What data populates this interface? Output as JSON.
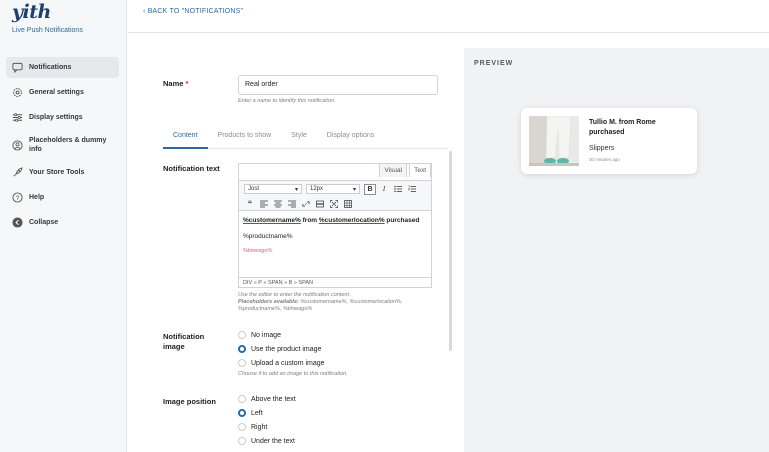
{
  "sidebar": {
    "logo_text": "yith",
    "plugin_name": "Live Push Notifications",
    "items": [
      {
        "label": "Notifications",
        "icon": "chat-icon"
      },
      {
        "label": "General settings",
        "icon": "gear-icon"
      },
      {
        "label": "Display settings",
        "icon": "sliders-icon"
      },
      {
        "label": "Placeholders & dummy info",
        "icon": "person-icon"
      },
      {
        "label": "Your Store Tools",
        "icon": "rocket-icon"
      },
      {
        "label": "Help",
        "icon": "help-icon"
      },
      {
        "label": "Collapse",
        "icon": "collapse-icon"
      }
    ]
  },
  "header": {
    "back_link": "BACK TO \"NOTIFICATIONS\""
  },
  "form": {
    "name_label": "Name",
    "name_required": "*",
    "name_value": "Real order",
    "name_hint": "Enter a name to identify this notification.",
    "tabs": [
      "Content",
      "Products to show",
      "Style",
      "Display options"
    ],
    "notification_text_label": "Notification text",
    "editor": {
      "tab_visual": "Visual",
      "tab_text": "Text",
      "font": "Jost",
      "size": "12px",
      "line1_p1": "%customername%",
      "line1_p2": " from ",
      "line1_p3": "%customerlocation%",
      "line1_p4": " purchased",
      "line2": "%productname%",
      "line3": "%timeago%",
      "path": "DIV » P » SPAN » B » SPAN"
    },
    "editor_hint1": "Use the editor to enter the notification content.",
    "editor_hint2_bold": "Placeholders available:",
    "editor_hint2": " %customername%, %customerlocation%,",
    "editor_hint3": "%productname%, %timeago%",
    "notification_image_label": "Notification image",
    "image_options": [
      "No image",
      "Use the product image",
      "Upload a custom image"
    ],
    "image_selected": 1,
    "image_hint": "Choose if to add an image to this notification.",
    "image_position_label": "Image position",
    "position_options": [
      "Above the text",
      "Left",
      "Right",
      "Under the text"
    ],
    "position_selected": 1
  },
  "preview": {
    "title": "PREVIEW",
    "notif_title": "Tullio M. from Rome purchased",
    "notif_product": "Slippers",
    "notif_time": "30 minutes ago"
  },
  "colors": {
    "accent": "#2b6aa3",
    "sidebar_bg": "#f6f7f8",
    "preview_bg": "#f1f2f3"
  }
}
